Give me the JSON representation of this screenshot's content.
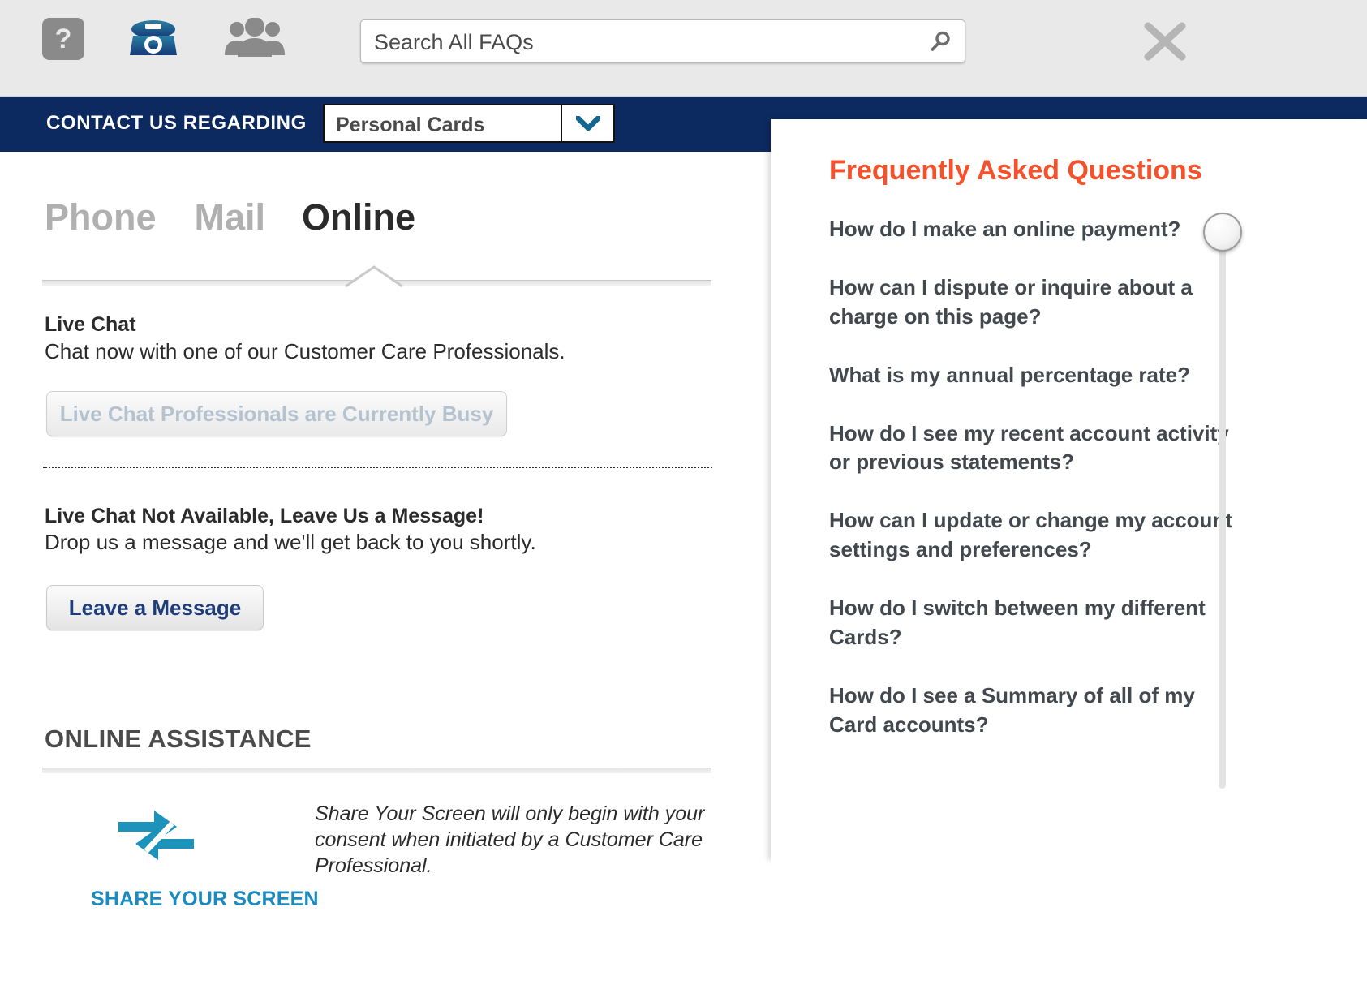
{
  "topbar": {
    "help_icon": "question-mark-icon",
    "phone_icon": "telephone-icon",
    "people_icon": "people-group-icon",
    "close_icon": "close-x-icon",
    "search": {
      "placeholder": "Search All FAQs",
      "value": "",
      "icon": "search-magnifier-icon"
    }
  },
  "contact_bar": {
    "label": "CONTACT US REGARDING",
    "dropdown": {
      "selected": "Personal Cards",
      "icon": "chevron-down-icon"
    },
    "background": "#0d2a60"
  },
  "tabs": [
    {
      "label": "Phone",
      "active": false
    },
    {
      "label": "Mail",
      "active": false
    },
    {
      "label": "Online",
      "active": true
    }
  ],
  "live_chat": {
    "title": "Live Chat",
    "body": "Chat now with one of our Customer Care Professionals.",
    "busy_button": "Live Chat Professionals are Currently Busy"
  },
  "leave_message": {
    "title": "Live Chat Not Available, Leave Us a Message!",
    "body": "Drop us a message and we'll get back to you shortly.",
    "button": "Leave a Message"
  },
  "online_assistance": {
    "heading": "ONLINE ASSISTANCE",
    "share_icon": "share-screen-arrows-icon",
    "share_label": "SHARE YOUR SCREEN",
    "note": "Share Your Screen will only begin with your consent when initiated by a Customer Care Professional.",
    "accent": "#1b8bbf"
  },
  "faq": {
    "title": "Frequently Asked Questions",
    "title_color": "#f4512c",
    "items": [
      "How do I make an online payment?",
      "How can I dispute or inquire about a charge on this page?",
      "What is my annual percentage rate?",
      "How do I see my recent account activity or previous statements?",
      "How can I update or change my account settings and preferences?",
      "How do I switch between my different Cards?",
      "How do I see a Summary of all of my Card accounts?"
    ]
  }
}
